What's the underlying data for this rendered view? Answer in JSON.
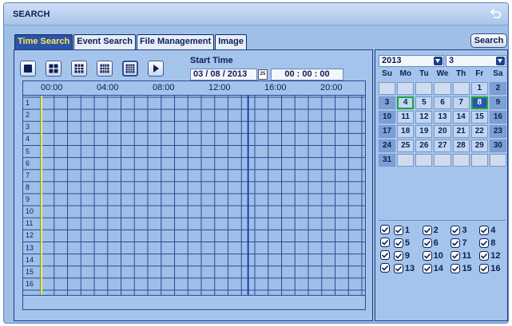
{
  "window": {
    "title": "SEARCH",
    "back_icon": "back-arrow-icon"
  },
  "tabs": [
    {
      "label": "Time Search",
      "active": true
    },
    {
      "label": "Event Search",
      "active": false
    },
    {
      "label": "File Management",
      "active": false
    },
    {
      "label": "Image",
      "active": false
    }
  ],
  "search_button": "Search",
  "toolbar": {
    "buttons": [
      {
        "icon": "single-view-icon"
      },
      {
        "icon": "quad-view-icon"
      },
      {
        "icon": "nine-view-icon"
      },
      {
        "icon": "twelve-view-icon"
      },
      {
        "icon": "sixteen-view-icon",
        "selected": true
      },
      {
        "icon": "play-icon"
      }
    ]
  },
  "start_time": {
    "label": "Start Time",
    "date": "03 / 08 / 2013",
    "time": "00 : 00 : 00",
    "calendar_icon_text": "25"
  },
  "timeline": {
    "hours": [
      "00:00",
      "04:00",
      "08:00",
      "12:00",
      "16:00",
      "20:00"
    ],
    "channels": [
      "1",
      "2",
      "3",
      "4",
      "5",
      "6",
      "7",
      "8",
      "9",
      "10",
      "11",
      "12",
      "13",
      "14",
      "15",
      "16"
    ]
  },
  "calendar": {
    "year": "2013",
    "month": "3",
    "weekdays": [
      "Su",
      "Mo",
      "Tu",
      "We",
      "Th",
      "Fr",
      "Sa"
    ],
    "weeks": [
      [
        "",
        "",
        "",
        "",
        "",
        "1",
        "2"
      ],
      [
        "3",
        "4",
        "5",
        "6",
        "7",
        "8",
        "9"
      ],
      [
        "10",
        "11",
        "12",
        "13",
        "14",
        "15",
        "16"
      ],
      [
        "17",
        "18",
        "19",
        "20",
        "21",
        "22",
        "23"
      ],
      [
        "24",
        "25",
        "26",
        "27",
        "28",
        "29",
        "30"
      ],
      [
        "31",
        "",
        "",
        "",
        "",
        "",
        ""
      ]
    ],
    "today": "4",
    "selected": "8",
    "accent": "#22a33a"
  },
  "channel_checkboxes": [
    [
      "1",
      "2",
      "3",
      "4"
    ],
    [
      "5",
      "6",
      "7",
      "8"
    ],
    [
      "9",
      "10",
      "11",
      "12"
    ],
    [
      "13",
      "14",
      "15",
      "16"
    ]
  ],
  "colors": {
    "tab_active_bg": "#2b53a8",
    "tab_active_text": "#ffe35a",
    "cursor_line": "#f0ee3a",
    "playhead": "#1d3fa8"
  }
}
